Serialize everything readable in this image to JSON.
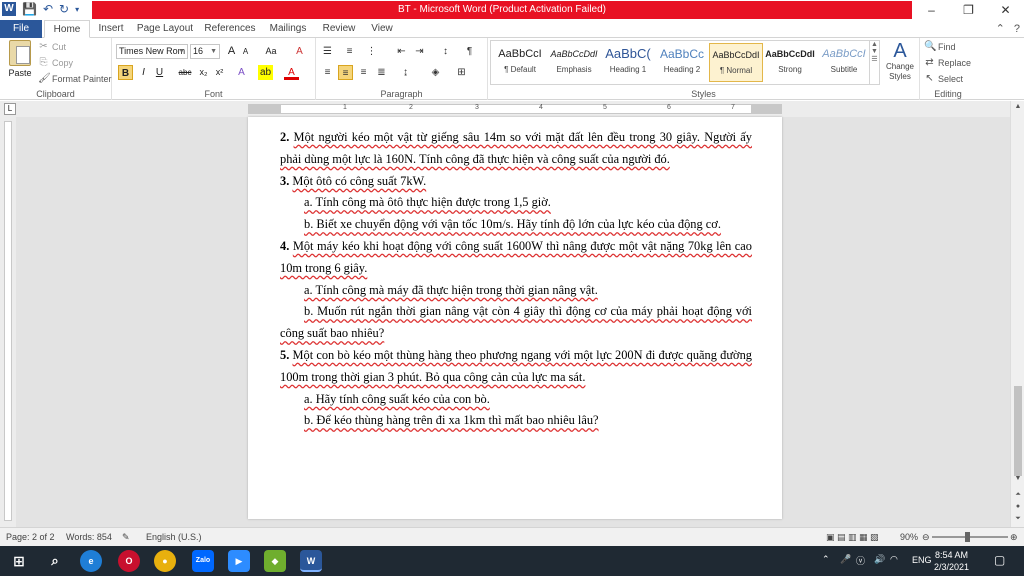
{
  "window": {
    "title": "BT - Microsoft Word (Product Activation Failed)",
    "app_icon": "W",
    "controls": [
      "–",
      "❐",
      "✕"
    ]
  },
  "tabs": [
    {
      "label": "File"
    },
    {
      "label": "Home"
    },
    {
      "label": "Insert"
    },
    {
      "label": "Page Layout"
    },
    {
      "label": "References"
    },
    {
      "label": "Mailings"
    },
    {
      "label": "Review"
    },
    {
      "label": "View"
    }
  ],
  "ribbon": {
    "clipboard": {
      "paste": "Paste",
      "cut": "Cut",
      "copy": "Copy",
      "format_painter": "Format Painter",
      "label": "Clipboard"
    },
    "font": {
      "family": "Times New Rom",
      "size": "16",
      "label": "Font",
      "bold": "B",
      "italic": "I",
      "underline": "U",
      "strike": "abc",
      "subscript": "x₂",
      "superscript": "x²",
      "grow": "A",
      "shrink": "A",
      "case": "Aa",
      "clear": "A"
    },
    "paragraph": {
      "label": "Paragraph",
      "pilcrow": "¶"
    },
    "styles": {
      "label": "Styles",
      "items": [
        {
          "sample": "AaBbCcI",
          "name": "¶ Default"
        },
        {
          "sample": "AaBbCcDdI",
          "name": "Emphasis"
        },
        {
          "sample": "AaBbC(",
          "name": "Heading 1"
        },
        {
          "sample": "AaBbCc",
          "name": "Heading 2"
        },
        {
          "sample": "AaBbCcDdI",
          "name": "¶ Normal"
        },
        {
          "sample": "AaBbCcDdI",
          "name": "Strong"
        },
        {
          "sample": "AaBbCcI",
          "name": "Subtitle"
        }
      ],
      "change_styles": "Change Styles"
    },
    "editing": {
      "label": "Editing",
      "find": "Find",
      "replace": "Replace",
      "select": "Select"
    }
  },
  "ruler": {
    "numbers": [
      "1",
      "2",
      "3",
      "4",
      "5",
      "6",
      "7"
    ]
  },
  "document": {
    "q2_num": "2.",
    "q2_text": "Một người kéo một vật từ giếng sâu 14m so với mặt đất lên đều trong 30 giây. Người ấy phải dùng một lực là 160N. Tính công đã thực hiện và công suất của người đó.",
    "q3_num": "3.",
    "q3_text": "Một ôtô có công suất 7kW.",
    "q3a": "a. Tính công mà ôtô thực hiện được trong 1,5 giờ.",
    "q3b": "b. Biết xe chuyển động với vận tốc 10m/s. Hãy tính độ lớn của lực kéo của động cơ.",
    "q4_num": "4.",
    "q4_text": "Một máy kéo khi hoạt động với công suất 1600W thì nâng được một vật nặng 70kg lên cao 10m trong 6 giây.",
    "q4a": "a. Tính công mà máy đã thực hiện trong thời gian nâng vật.",
    "q4b": "b. Muốn rút ngắn thời gian nâng vật còn 4 giây thì động cơ của máy phải hoạt động với công suất bao nhiêu?",
    "q5_num": "5.",
    "q5_text": "Một con bò kéo một thùng hàng theo phương ngang với một lực 200N đi được quãng đường 100m trong thời gian 3 phút. Bỏ qua công cản của lực ma sát.",
    "q5a": "a. Hãy tính công suất kéo của con bò.",
    "q5b": "b. Để kéo thùng hàng trên đi xa 1km thì mất bao nhiêu lâu?"
  },
  "status": {
    "page": "Page: 2 of 2",
    "words": "Words: 854",
    "language": "English (U.S.)",
    "zoom": "90%"
  },
  "taskbar": {
    "lang": "ENG",
    "time": "8:54 AM",
    "date": "2/3/2021",
    "zalo": "Zalo"
  },
  "colors": {
    "word_blue": "#2b579a",
    "title_red": "#e81123"
  }
}
